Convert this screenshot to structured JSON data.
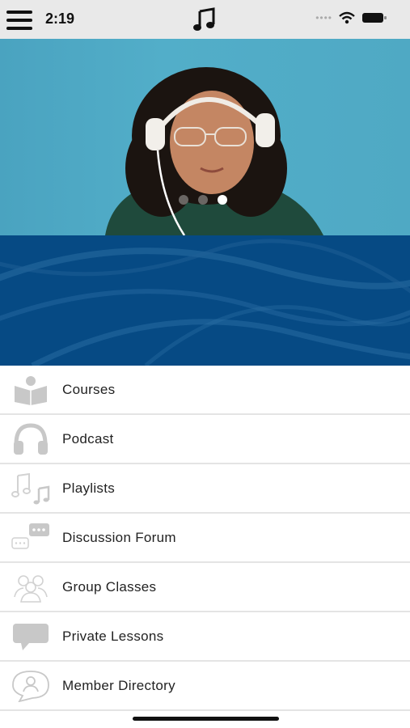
{
  "status_bar": {
    "time": "2:19",
    "menu_icon": "hamburger-menu-icon",
    "center_icon": "music-note-icon",
    "wifi_icon": "wifi-icon",
    "battery_icon": "battery-icon"
  },
  "hero": {
    "carousel": {
      "total": 3,
      "active_index": 2
    }
  },
  "menu": {
    "items": [
      {
        "label": "Courses",
        "icon": "courses-icon"
      },
      {
        "label": "Podcast",
        "icon": "headphones-icon"
      },
      {
        "label": "Playlists",
        "icon": "music-notes-icon"
      },
      {
        "label": "Discussion Forum",
        "icon": "chat-bubbles-icon"
      },
      {
        "label": "Group Classes",
        "icon": "group-icon"
      },
      {
        "label": "Private Lessons",
        "icon": "speech-bubble-icon"
      },
      {
        "label": "Member Directory",
        "icon": "person-bubble-icon"
      }
    ]
  },
  "colors": {
    "status_bar_bg": "#e9e9e9",
    "hero_bg": "#4fa9c4",
    "banner_bg": "#064a84",
    "icon_gray": "#c8c8c8"
  }
}
